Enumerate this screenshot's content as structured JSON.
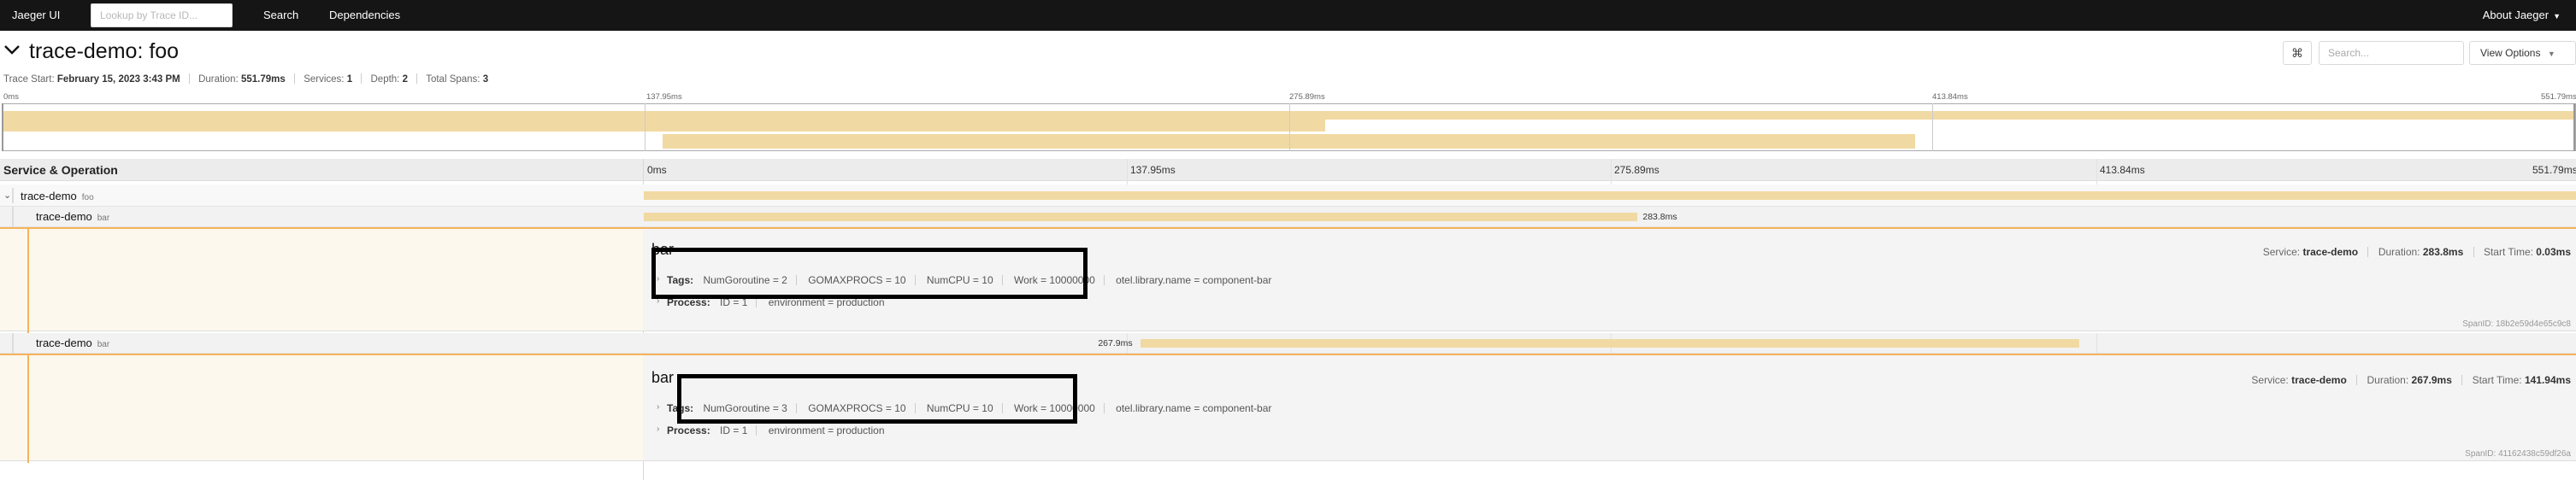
{
  "nav": {
    "brand": "Jaeger UI",
    "lookup_placeholder": "Lookup by Trace ID...",
    "search": "Search",
    "dependencies": "Dependencies",
    "about": "About Jaeger"
  },
  "trace": {
    "title": "trace-demo: foo",
    "start_label": "Trace Start:",
    "start_value": "February 15, 2023 3:43 PM",
    "duration_label": "Duration:",
    "duration_value": "551.79ms",
    "services_label": "Services:",
    "services_value": "1",
    "depth_label": "Depth:",
    "depth_value": "2",
    "total_spans_label": "Total Spans:",
    "total_spans_value": "3"
  },
  "toolbar": {
    "cmd_icon": "⌘",
    "search_placeholder": "Search...",
    "view_options": "View Options"
  },
  "ticks": [
    "0ms",
    "137.95ms",
    "275.89ms",
    "413.84ms",
    "551.79ms"
  ],
  "timeline": {
    "header_left": "Service & Operation"
  },
  "spans": [
    {
      "service": "trace-demo",
      "operation": "foo",
      "start_ms": 0,
      "duration_ms": 551.79
    },
    {
      "service": "trace-demo",
      "operation": "bar",
      "start_ms": 0,
      "duration_ms": 283.8,
      "duration_label": "283.8ms",
      "detail": {
        "name": "bar",
        "service_label": "Service:",
        "service_value": "trace-demo",
        "duration_label": "Duration:",
        "duration_value": "283.8ms",
        "start_label": "Start Time:",
        "start_value": "0.03ms",
        "tags_label": "Tags:",
        "tags": [
          "NumGoroutine = 2",
          "GOMAXPROCS = 10",
          "NumCPU = 10",
          "Work = 10000000",
          "otel.library.name = component-bar"
        ],
        "process_label": "Process:",
        "process": [
          "ID = 1",
          "environment = production"
        ],
        "spanid_label": "SpanID:",
        "spanid": "18b2e59d4e65c9c8"
      }
    },
    {
      "service": "trace-demo",
      "operation": "bar",
      "start_ms": 141.94,
      "duration_ms": 267.9,
      "duration_label": "267.9ms",
      "detail": {
        "name": "bar",
        "service_label": "Service:",
        "service_value": "trace-demo",
        "duration_label": "Duration:",
        "duration_value": "267.9ms",
        "start_label": "Start Time:",
        "start_value": "141.94ms",
        "tags_label": "Tags:",
        "tags": [
          "NumGoroutine = 3",
          "GOMAXPROCS = 10",
          "NumCPU = 10",
          "Work = 10000000",
          "otel.library.name = component-bar"
        ],
        "process_label": "Process:",
        "process": [
          "ID = 1",
          "environment = production"
        ],
        "spanid_label": "SpanID:",
        "spanid": "41162438c59df26a"
      }
    }
  ],
  "colors": {
    "nav_bg": "#151515",
    "span_bar": "#f1d9a3",
    "selected_accent": "#f5b35c",
    "highlight_box": "#000000"
  }
}
